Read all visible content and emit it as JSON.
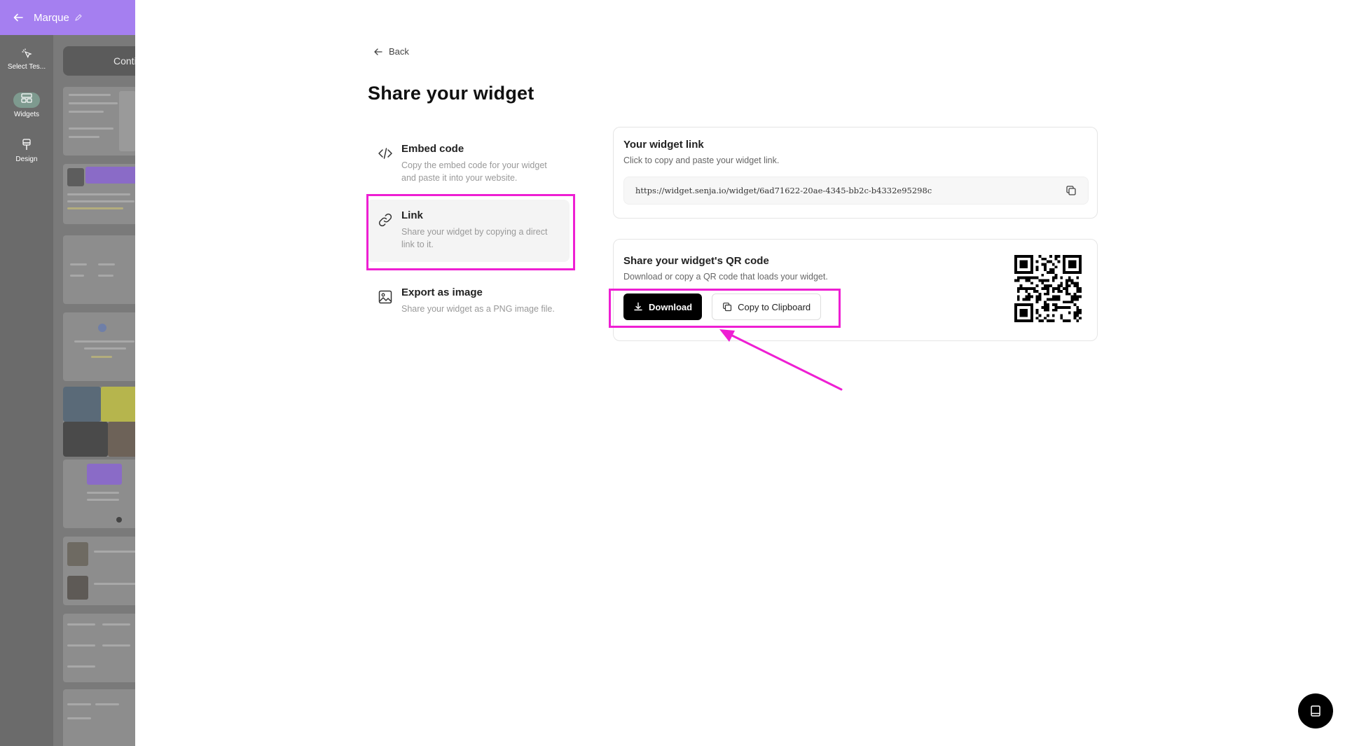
{
  "app": {
    "project_name": "Marque",
    "rail": [
      {
        "label": "Select Tes..."
      },
      {
        "label": "Widgets"
      },
      {
        "label": "Design"
      }
    ],
    "panel_button": "Conti"
  },
  "page": {
    "back_label": "Back",
    "title": "Share your widget"
  },
  "options": [
    {
      "title": "Embed code",
      "description": "Copy the embed code for your widget and paste it into your website.",
      "icon": "code-icon"
    },
    {
      "title": "Link",
      "description": "Share your widget by copying a direct link to it.",
      "icon": "link-icon",
      "selected": true
    },
    {
      "title": "Export as image",
      "description": "Share your widget as a PNG image file.",
      "icon": "image-icon"
    }
  ],
  "widget_link_card": {
    "title": "Your widget link",
    "subtitle": "Click to copy and paste your widget link.",
    "url": "https://widget.senja.io/widget/6ad71622-20ae-4345-bb2c-b4332e95298c"
  },
  "qr_card": {
    "title": "Share your widget's QR code",
    "subtitle": "Download or copy a QR code that loads your widget.",
    "download_label": "Download",
    "copy_label": "Copy to Clipboard"
  },
  "colors": {
    "highlight": "#ee1fd3",
    "brand_purple": "#a57ff0",
    "primary_button": "#000000"
  }
}
